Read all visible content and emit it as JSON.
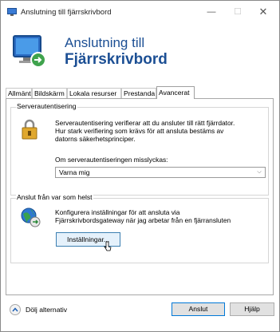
{
  "window": {
    "title": "Anslutning till fjärrskrivbord",
    "controls": {
      "minimize": "—",
      "maximize": "☐",
      "close": "✕"
    }
  },
  "banner": {
    "line1": "Anslutning till",
    "line2": "Fjärrskrivbord"
  },
  "tabs": [
    {
      "label": "Allmänt",
      "active": false
    },
    {
      "label": "Bildskärm",
      "active": false
    },
    {
      "label": "Lokala resurser",
      "active": false
    },
    {
      "label": "Prestanda",
      "active": false
    },
    {
      "label": "Avancerat",
      "active": true
    }
  ],
  "server_auth": {
    "title": "Serverautentisering",
    "description": [
      "Serverautentisering verifierar att du ansluter till rätt fjärrdator.",
      "Hur stark verifiering som krävs för att ansluta bestäms av",
      "datorns säkerhetsprinciper."
    ],
    "fail_label": "Om serverautentiseringen misslyckas:",
    "fail_value": "Varna mig"
  },
  "connect_anywhere": {
    "title": "Anslut från var som helst",
    "description": [
      "Konfigurera inställningar för att ansluta via",
      "Fjärrskrivbordsgateway när jag arbetar från en fjärransluten"
    ],
    "settings_button": "Inställningar..."
  },
  "footer": {
    "hide_options": "Dölj alternativ",
    "connect_button": "Anslut",
    "help_button": "Hjälp"
  },
  "colors": {
    "banner_text": "#1c4f94",
    "focus_border": "#0078d7"
  }
}
